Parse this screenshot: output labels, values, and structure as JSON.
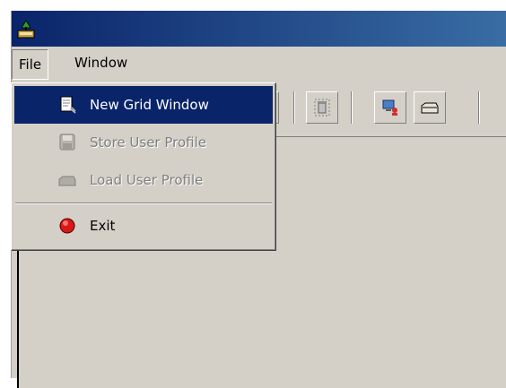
{
  "menubar": {
    "file": "File",
    "window": "Window"
  },
  "file_menu": {
    "items": [
      {
        "label": "New Grid Window",
        "icon": "new-grid-window-icon",
        "state": "highlighted"
      },
      {
        "label": "Store User Profile",
        "icon": "save-disk-icon",
        "state": "disabled"
      },
      {
        "label": "Load User Profile",
        "icon": "folder-icon",
        "state": "disabled"
      },
      {
        "label": "Exit",
        "icon": "exit-red-circle-icon",
        "state": "enabled"
      }
    ]
  },
  "toolbar": {
    "buttons": [
      "tree-icon",
      "trash-icon",
      "user-computer-icon",
      "folder-icon"
    ]
  },
  "colors": {
    "selection": "#0a246a",
    "face": "#d4d0c8",
    "title_start": "#0a246a",
    "title_end": "#3a6ea5"
  }
}
